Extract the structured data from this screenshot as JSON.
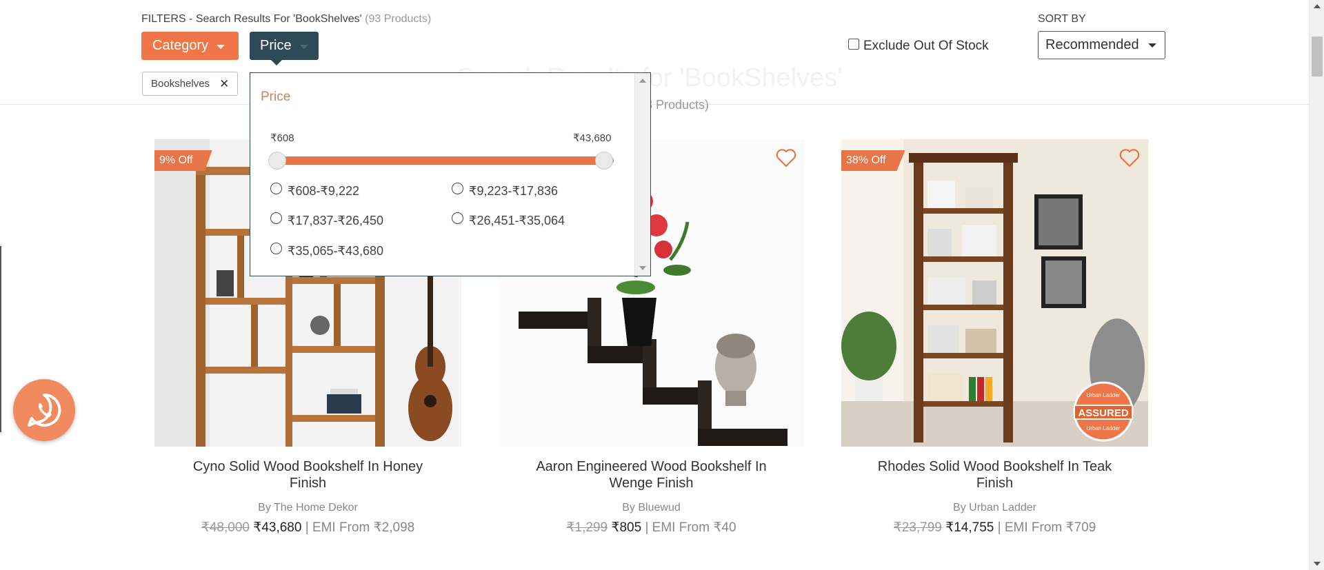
{
  "filters": {
    "title_prefix": "FILTERS - Search Results For 'BookShelves'",
    "count": "(93 Products)",
    "category_label": "Category",
    "price_label": "Price",
    "active_chip": "Bookshelves",
    "exclude_label": "Exclude Out Of Stock",
    "sort_label": "SORT BY",
    "sort_value": "Recommended"
  },
  "background": {
    "heading": "Search Results for 'BookShelves'",
    "subheading": "(93 Products)"
  },
  "price_dropdown": {
    "title": "Price",
    "min": "₹608",
    "max": "₹43,680",
    "options": [
      "₹608-₹9,222",
      "₹9,223-₹17,836",
      "₹17,837-₹26,450",
      "₹26,451-₹35,064",
      "₹35,065-₹43,680"
    ]
  },
  "products": [
    {
      "discount": "9% Off",
      "name": "Cyno Solid Wood Bookshelf In Honey Finish",
      "brand": "By The Home Dekor",
      "mrp": "₹48,000",
      "price": "₹43,680",
      "emi": "| EMI From ₹2,098"
    },
    {
      "discount": "",
      "name": "Aaron Engineered Wood Bookshelf In Wenge Finish",
      "brand": "By Bluewud",
      "mrp": "₹1,299",
      "price": "₹805",
      "emi": "| EMI From ₹40"
    },
    {
      "discount": "38% Off",
      "name": "Rhodes Solid Wood Bookshelf In Teak Finish",
      "brand": "By Urban Ladder",
      "mrp": "₹23,799",
      "price": "₹14,755",
      "emi": "| EMI From ₹709",
      "badge_top": "Urban Ladder",
      "badge_mid": "ASSURED",
      "badge_bottom": "Urban Ladder"
    }
  ],
  "colors": {
    "accent": "#f07548",
    "dark": "#2e4a57",
    "whatsapp": "#f28a60"
  }
}
